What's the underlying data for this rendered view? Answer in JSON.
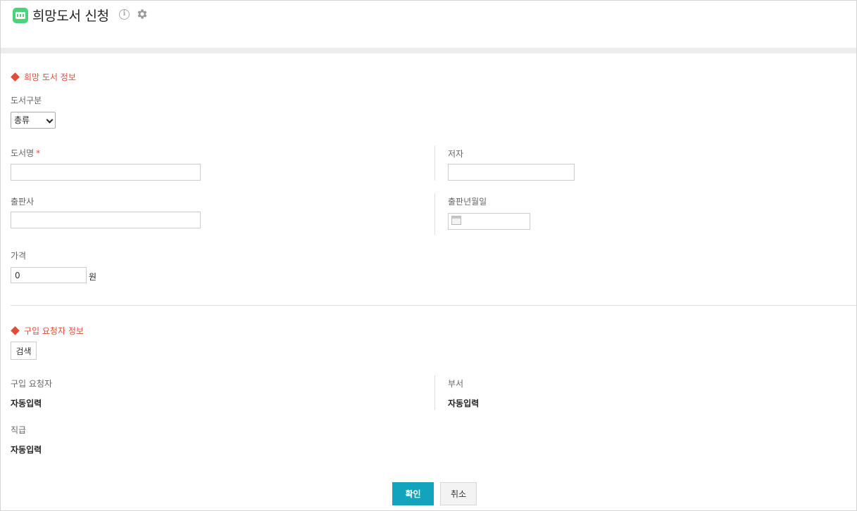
{
  "header": {
    "title": "희망도서 신청",
    "icons": {
      "app": "book-shelf-icon",
      "info": "info-icon",
      "settings": "gear-icon"
    },
    "info_glyph": "i"
  },
  "colors": {
    "accent": "#e04e3a",
    "primary_button": "#12a3bd",
    "app_icon": "#4cd27a"
  },
  "book_section": {
    "title": "희망 도서 정보",
    "category": {
      "label": "도서구분",
      "selected": "총류"
    },
    "book_name": {
      "label": "도서명",
      "required_mark": "*",
      "value": ""
    },
    "author": {
      "label": "저자",
      "value": ""
    },
    "publisher": {
      "label": "출판사",
      "value": ""
    },
    "pub_date": {
      "label": "출판년월일",
      "value": ""
    },
    "price": {
      "label": "가격",
      "value": "0",
      "unit": "원"
    }
  },
  "requester_section": {
    "title": "구입 요청자 정보",
    "search_label": "검색",
    "requester": {
      "label": "구입 요청자",
      "value": "자동입력"
    },
    "department": {
      "label": "부서",
      "value": "자동입력"
    },
    "position": {
      "label": "직급",
      "value": "자동입력"
    }
  },
  "actions": {
    "confirm": "확인",
    "cancel": "취소"
  }
}
